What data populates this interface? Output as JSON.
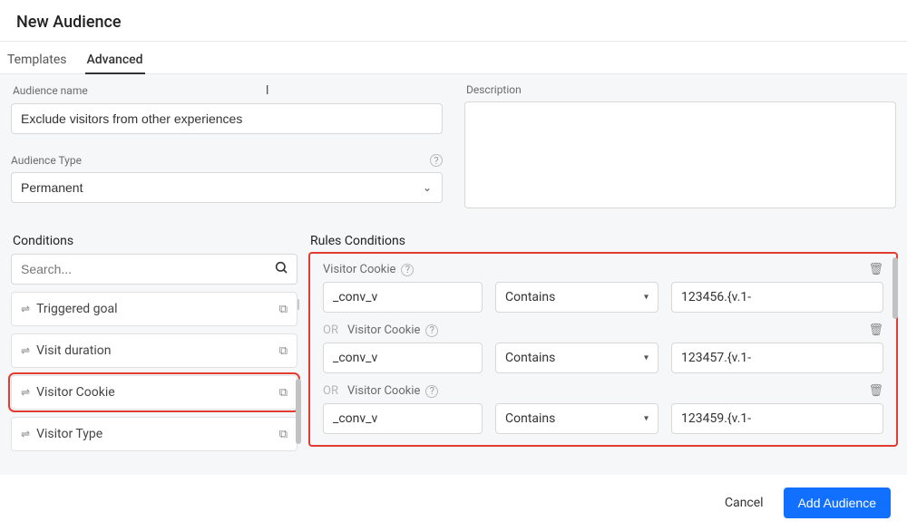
{
  "header": {
    "title": "New Audience"
  },
  "tabs": [
    {
      "id": "templates",
      "label": "Templates",
      "active": false
    },
    {
      "id": "advanced",
      "label": "Advanced",
      "active": true
    }
  ],
  "fields": {
    "name_label": "Audience name",
    "name_value": "Exclude visitors from other experiences",
    "type_label": "Audience Type",
    "type_value": "Permanent",
    "desc_label": "Description",
    "desc_value": ""
  },
  "sections": {
    "conditions": "Conditions",
    "rules": "Rules Conditions"
  },
  "search": {
    "placeholder": "Search..."
  },
  "conditions": [
    {
      "label": "Triggered goal",
      "selected": false
    },
    {
      "label": "Visit duration",
      "selected": false
    },
    {
      "label": "Visitor Cookie",
      "selected": true
    },
    {
      "label": "Visitor Type",
      "selected": false
    }
  ],
  "rules": [
    {
      "prefix": "",
      "type": "Visitor Cookie",
      "name": "_conv_v",
      "op": "Contains",
      "value": "123456.{v.1-"
    },
    {
      "prefix": "OR",
      "type": "Visitor Cookie",
      "name": "_conv_v",
      "op": "Contains",
      "value": "123457.{v.1-"
    },
    {
      "prefix": "OR",
      "type": "Visitor Cookie",
      "name": "_conv_v",
      "op": "Contains",
      "value": "123459.{v.1-"
    }
  ],
  "footer": {
    "cancel": "Cancel",
    "primary": "Add Audience"
  }
}
